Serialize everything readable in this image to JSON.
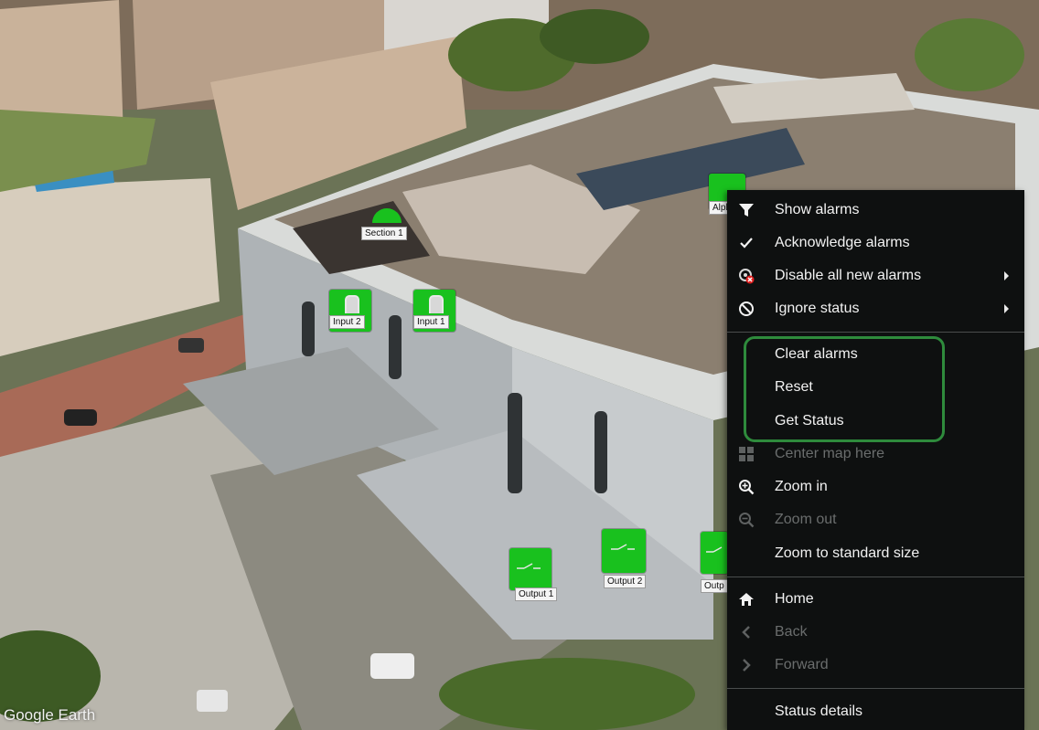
{
  "map": {
    "watermark": "Google Earth",
    "markers": [
      {
        "id": "section-1",
        "label": "Section 1"
      },
      {
        "id": "input-2",
        "label": "Input 2"
      },
      {
        "id": "input-1",
        "label": "Input 1"
      },
      {
        "id": "alpha",
        "label": "Alph"
      },
      {
        "id": "output-1",
        "label": "Output 1"
      },
      {
        "id": "output-2",
        "label": "Output 2"
      },
      {
        "id": "output-3",
        "label": "Outp"
      }
    ],
    "marker_color": "#19c11e"
  },
  "context_menu": {
    "items": [
      {
        "label": "Show alarms",
        "icon": "funnel-icon",
        "enabled": true
      },
      {
        "label": "Acknowledge alarms",
        "icon": "checkmark-icon",
        "enabled": true
      },
      {
        "label": "Disable all new alarms",
        "icon": "alarm-disable-icon",
        "enabled": true,
        "submenu": true
      },
      {
        "label": "Ignore status",
        "icon": "prohibited-icon",
        "enabled": true,
        "submenu": true
      },
      {
        "label": "Clear alarms",
        "enabled": true
      },
      {
        "label": "Reset",
        "enabled": true
      },
      {
        "label": "Get Status",
        "enabled": true
      },
      {
        "label": "Center map here",
        "icon": "grid-icon",
        "enabled": false
      },
      {
        "label": "Zoom in",
        "icon": "zoom-in-icon",
        "enabled": true
      },
      {
        "label": "Zoom out",
        "icon": "zoom-out-icon",
        "enabled": false
      },
      {
        "label": "Zoom to standard size",
        "enabled": true
      },
      {
        "label": "Home",
        "icon": "home-icon",
        "enabled": true
      },
      {
        "label": "Back",
        "icon": "chevron-left-icon",
        "enabled": false
      },
      {
        "label": "Forward",
        "icon": "chevron-right-icon",
        "enabled": false
      },
      {
        "label": "Status details",
        "enabled": true
      }
    ],
    "highlight_color": "#2e8b3c",
    "background": "#0e1010"
  }
}
